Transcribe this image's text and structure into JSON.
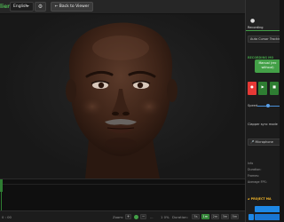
{
  "header": {
    "brand": "lier",
    "language": "English",
    "settings_icon": "gear-icon",
    "back_button": "← Back to Viewer"
  },
  "viewport": {
    "subject": "3d-head-model",
    "skin_color": "#4a2d20"
  },
  "bottom_bar": {
    "time": "0 : 00",
    "zoom_label": "Zoom:",
    "zoom_in": "+",
    "zoom_out": "−",
    "zoom_percent": "...",
    "fps": "1 0%",
    "duration_label": "Duration:",
    "duration_options": [
      "5s",
      "1m",
      "2m",
      "3m",
      "5m"
    ],
    "duration_active_index": 1
  },
  "panel": {
    "tab_label": "Recording",
    "tab_icon": "record-icon",
    "auto_cursor": "Auto Cursor Tracking",
    "recording_section": "RECORDING MO",
    "manual_button": "Manual (rec\nwithout)",
    "speed_label": "Speed",
    "speed_value": 0.45,
    "clapper": "Clapper sync mode",
    "microphone": "Microphone",
    "info_rows": [
      "Info",
      "Duration:",
      "Frames:",
      "Average FPS:"
    ],
    "project_section": "PROJECT MA",
    "accent": "#43a047",
    "record_color": "#e53935",
    "blue": "#1e88e5"
  }
}
